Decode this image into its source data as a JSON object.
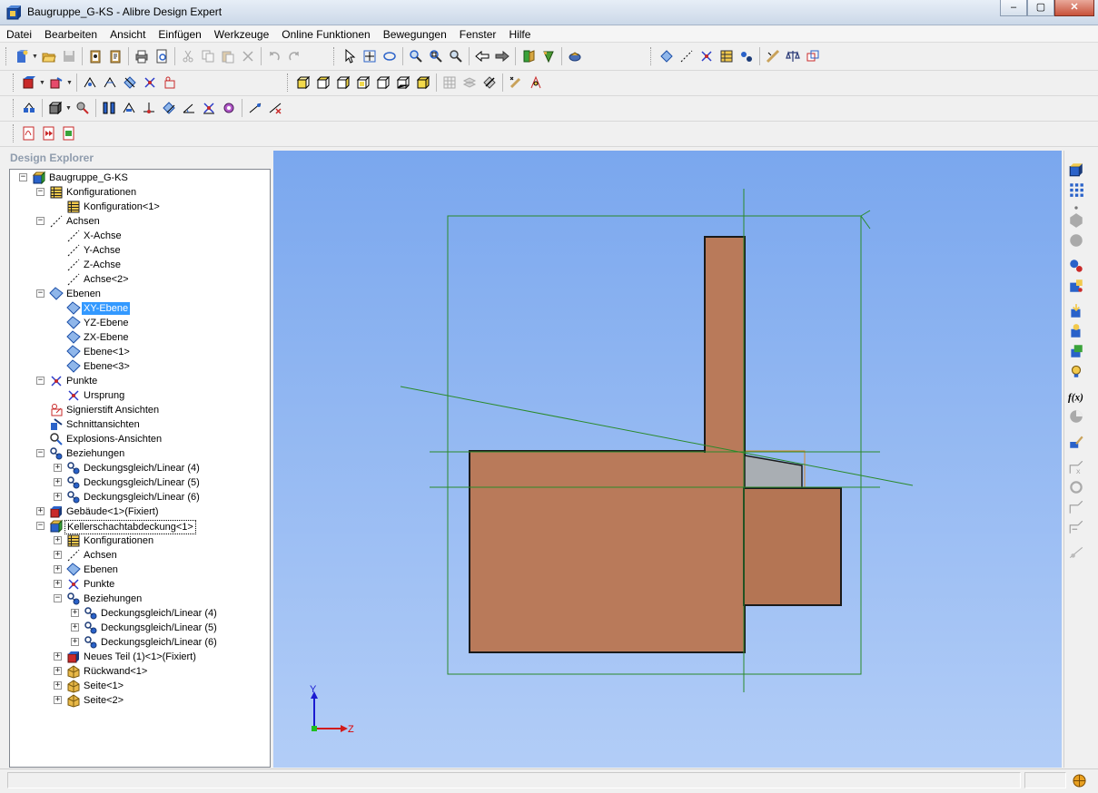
{
  "window": {
    "title": "Baugruppe_G-KS - Alibre Design Expert",
    "minimize": "–",
    "maximize": "▢",
    "close": "✕"
  },
  "menu": [
    "Datei",
    "Bearbeiten",
    "Ansicht",
    "Einfügen",
    "Werkzeuge",
    "Online Funktionen",
    "Bewegungen",
    "Fenster",
    "Hilfe"
  ],
  "explorer": {
    "title": "Design Explorer",
    "tree": [
      {
        "label": "Baugruppe_G-KS",
        "level": 0,
        "exp": "−",
        "icon": "assembly-icon"
      },
      {
        "label": "Konfigurationen",
        "level": 1,
        "exp": "−",
        "icon": "table-icon"
      },
      {
        "label": "Konfiguration<1>",
        "level": 2,
        "exp": "",
        "icon": "table-icon"
      },
      {
        "label": "Achsen",
        "level": 1,
        "exp": "−",
        "icon": "axis-icon"
      },
      {
        "label": "X-Achse",
        "level": 2,
        "exp": "",
        "icon": "axis-icon"
      },
      {
        "label": "Y-Achse",
        "level": 2,
        "exp": "",
        "icon": "axis-icon"
      },
      {
        "label": "Z-Achse",
        "level": 2,
        "exp": "",
        "icon": "axis-icon"
      },
      {
        "label": "Achse<2>",
        "level": 2,
        "exp": "",
        "icon": "axis-icon"
      },
      {
        "label": "Ebenen",
        "level": 1,
        "exp": "−",
        "icon": "plane-icon"
      },
      {
        "label": "XY-Ebene",
        "level": 2,
        "exp": "",
        "icon": "plane-icon",
        "selected": true
      },
      {
        "label": "YZ-Ebene",
        "level": 2,
        "exp": "",
        "icon": "plane-icon"
      },
      {
        "label": "ZX-Ebene",
        "level": 2,
        "exp": "",
        "icon": "plane-icon"
      },
      {
        "label": "Ebene<1>",
        "level": 2,
        "exp": "",
        "icon": "plane-icon"
      },
      {
        "label": "Ebene<3>",
        "level": 2,
        "exp": "",
        "icon": "plane-icon"
      },
      {
        "label": "Punkte",
        "level": 1,
        "exp": "−",
        "icon": "point-icon"
      },
      {
        "label": "Ursprung",
        "level": 2,
        "exp": "",
        "icon": "point-icon"
      },
      {
        "label": "Signierstift Ansichten",
        "level": 1,
        "exp": "",
        "icon": "redline-icon"
      },
      {
        "label": "Schnittansichten",
        "level": 1,
        "exp": "",
        "icon": "section-icon"
      },
      {
        "label": "Explosions-Ansichten",
        "level": 1,
        "exp": "",
        "icon": "explode-icon"
      },
      {
        "label": "Beziehungen",
        "level": 1,
        "exp": "−",
        "icon": "constraint-icon"
      },
      {
        "label": "Deckungsgleich/Linear (4)",
        "level": 2,
        "exp": "+",
        "icon": "constraint-icon"
      },
      {
        "label": "Deckungsgleich/Linear (5)",
        "level": 2,
        "exp": "+",
        "icon": "constraint-icon"
      },
      {
        "label": "Deckungsgleich/Linear (6)",
        "level": 2,
        "exp": "+",
        "icon": "constraint-icon"
      },
      {
        "label": "Gebäude<1>(Fixiert)",
        "level": 1,
        "exp": "+",
        "icon": "fixed-part-icon"
      },
      {
        "label": "Kellerschachtabdeckung<1>",
        "level": 1,
        "exp": "−",
        "icon": "subassembly-icon",
        "focused": true
      },
      {
        "label": "Konfigurationen",
        "level": 2,
        "exp": "+",
        "icon": "table-icon"
      },
      {
        "label": "Achsen",
        "level": 2,
        "exp": "+",
        "icon": "axis-icon"
      },
      {
        "label": "Ebenen",
        "level": 2,
        "exp": "+",
        "icon": "plane-icon"
      },
      {
        "label": "Punkte",
        "level": 2,
        "exp": "+",
        "icon": "point-icon"
      },
      {
        "label": "Beziehungen",
        "level": 2,
        "exp": "−",
        "icon": "constraint-icon"
      },
      {
        "label": "Deckungsgleich/Linear (4)",
        "level": 3,
        "exp": "+",
        "icon": "constraint-icon"
      },
      {
        "label": "Deckungsgleich/Linear (5)",
        "level": 3,
        "exp": "+",
        "icon": "constraint-icon"
      },
      {
        "label": "Deckungsgleich/Linear (6)",
        "level": 3,
        "exp": "+",
        "icon": "constraint-icon"
      },
      {
        "label": "Neues Teil (1)<1>(Fixiert)",
        "level": 2,
        "exp": "+",
        "icon": "fixed-part-icon"
      },
      {
        "label": "Rückwand<1>",
        "level": 2,
        "exp": "+",
        "icon": "part-icon"
      },
      {
        "label": "Seite<1>",
        "level": 2,
        "exp": "+",
        "icon": "part-icon"
      },
      {
        "label": "Seite<2>",
        "level": 2,
        "exp": "+",
        "icon": "part-icon"
      }
    ]
  },
  "viewport": {
    "axis_y": "Y",
    "axis_z": "Z",
    "colors": {
      "background_top": "#7aa7ee",
      "background_bottom": "#b2cdf7",
      "part": "#b97a5a",
      "sketch_lines": "#2a8a2a",
      "thin_part": "#a9aeb3"
    }
  }
}
